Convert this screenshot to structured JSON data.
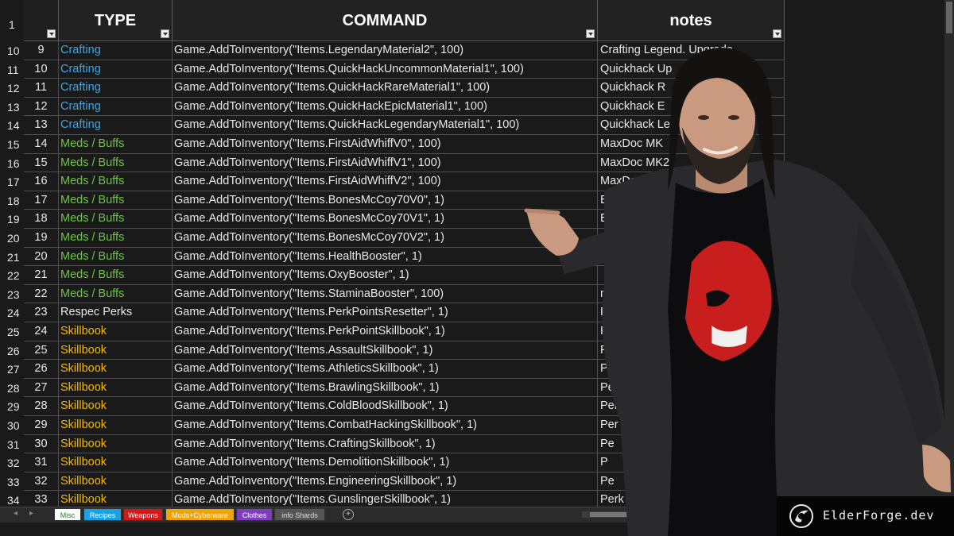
{
  "headers": {
    "type": "TYPE",
    "command": "COMMAND",
    "notes": "notes"
  },
  "first_row_number": "1",
  "colors": {
    "crafting": "#3aa8e8",
    "meds": "#6ec543",
    "skillbook": "#f5b800",
    "default": "#e8e8e8"
  },
  "rows": [
    {
      "row": "10",
      "idx": "9",
      "type": "Crafting",
      "kind": "crafting",
      "command": "Game.AddToInventory(\"Items.LegendaryMaterial2\", 100)",
      "notes": "Crafting Legend. Upgrade"
    },
    {
      "row": "11",
      "idx": "10",
      "type": "Crafting",
      "kind": "crafting",
      "command": "Game.AddToInventory(\"Items.QuickHackUncommonMaterial1\", 100)",
      "notes": "Quickhack Up"
    },
    {
      "row": "12",
      "idx": "11",
      "type": "Crafting",
      "kind": "crafting",
      "command": "Game.AddToInventory(\"Items.QuickHackRareMaterial1\", 100)",
      "notes": "Quickhack R"
    },
    {
      "row": "13",
      "idx": "12",
      "type": "Crafting",
      "kind": "crafting",
      "command": "Game.AddToInventory(\"Items.QuickHackEpicMaterial1\", 100)",
      "notes": "Quickhack E"
    },
    {
      "row": "14",
      "idx": "13",
      "type": "Crafting",
      "kind": "crafting",
      "command": "Game.AddToInventory(\"Items.QuickHackLegendaryMaterial1\", 100)",
      "notes": "Quickhack Le"
    },
    {
      "row": "15",
      "idx": "14",
      "type": "Meds / Buffs",
      "kind": "meds",
      "command": "Game.AddToInventory(\"Items.FirstAidWhiffV0\", 100)",
      "notes": "MaxDoc MK"
    },
    {
      "row": "16",
      "idx": "15",
      "type": "Meds / Buffs",
      "kind": "meds",
      "command": "Game.AddToInventory(\"Items.FirstAidWhiffV1\", 100)",
      "notes": "MaxDoc MK2"
    },
    {
      "row": "17",
      "idx": "16",
      "type": "Meds / Buffs",
      "kind": "meds",
      "command": "Game.AddToInventory(\"Items.FirstAidWhiffV2\", 100)",
      "notes": "MaxDoc MK"
    },
    {
      "row": "18",
      "idx": "17",
      "type": "Meds / Buffs",
      "kind": "meds",
      "command": "Game.AddToInventory(\"Items.BonesMcCoy70V0\", 1)",
      "notes": "Bo"
    },
    {
      "row": "19",
      "idx": "18",
      "type": "Meds / Buffs",
      "kind": "meds",
      "command": "Game.AddToInventory(\"Items.BonesMcCoy70V1\", 1)",
      "notes": "B"
    },
    {
      "row": "20",
      "idx": "19",
      "type": "Meds / Buffs",
      "kind": "meds",
      "command": "Game.AddToInventory(\"Items.BonesMcCoy70V2\", 1)",
      "notes": ""
    },
    {
      "row": "21",
      "idx": "20",
      "type": "Meds / Buffs",
      "kind": "meds",
      "command": "Game.AddToInventory(\"Items.HealthBooster\", 1)",
      "notes": ""
    },
    {
      "row": "22",
      "idx": "21",
      "type": "Meds / Buffs",
      "kind": "meds",
      "command": "Game.AddToInventory(\"Items.OxyBooster\", 1)",
      "notes": ""
    },
    {
      "row": "23",
      "idx": "22",
      "type": "Meds / Buffs",
      "kind": "meds",
      "command": "Game.AddToInventory(\"Items.StaminaBooster\", 100)",
      "notes": "mina"
    },
    {
      "row": "24",
      "idx": "23",
      "type": "Respec Perks",
      "kind": "default",
      "command": "Game.AddToInventory(\"Items.PerkPointsResetter\", 1)",
      "notes": "Reset Pe"
    },
    {
      "row": "25",
      "idx": "24",
      "type": "Skillbook",
      "kind": "skillbook",
      "command": "Game.AddToInventory(\"Items.PerkPointSkillbook\", 1)",
      "notes": "Perk"
    },
    {
      "row": "26",
      "idx": "25",
      "type": "Skillbook",
      "kind": "skillbook",
      "command": "Game.AddToInventory(\"Items.AssaultSkillbook\", 1)",
      "notes": "Perk - A"
    },
    {
      "row": "27",
      "idx": "26",
      "type": "Skillbook",
      "kind": "skillbook",
      "command": "Game.AddToInventory(\"Items.AthleticsSkillbook\", 1)",
      "notes": "Perk - A"
    },
    {
      "row": "28",
      "idx": "27",
      "type": "Skillbook",
      "kind": "skillbook",
      "command": "Game.AddToInventory(\"Items.BrawlingSkillbook\", 1)",
      "notes": "Perk"
    },
    {
      "row": "29",
      "idx": "28",
      "type": "Skillbook",
      "kind": "skillbook",
      "command": "Game.AddToInventory(\"Items.ColdBloodSkillbook\", 1)",
      "notes": "Perk"
    },
    {
      "row": "30",
      "idx": "29",
      "type": "Skillbook",
      "kind": "skillbook",
      "command": "Game.AddToInventory(\"Items.CombatHackingSkillbook\", 1)",
      "notes": "Per"
    },
    {
      "row": "31",
      "idx": "30",
      "type": "Skillbook",
      "kind": "skillbook",
      "command": "Game.AddToInventory(\"Items.CraftingSkillbook\", 1)",
      "notes": "Pe"
    },
    {
      "row": "32",
      "idx": "31",
      "type": "Skillbook",
      "kind": "skillbook",
      "command": "Game.AddToInventory(\"Items.DemolitionSkillbook\", 1)",
      "notes": "P"
    },
    {
      "row": "33",
      "idx": "32",
      "type": "Skillbook",
      "kind": "skillbook",
      "command": "Game.AddToInventory(\"Items.EngineeringSkillbook\", 1)",
      "notes": "Pe"
    },
    {
      "row": "34",
      "idx": "33",
      "type": "Skillbook",
      "kind": "skillbook",
      "command": "Game.AddToInventory(\"Items.GunslingerSkillbook\", 1)",
      "notes": "Perk"
    }
  ],
  "tabs": [
    {
      "label": "Misc",
      "bg": "#ffffff",
      "fg": "#1e7a1e",
      "active": true
    },
    {
      "label": "Recipes",
      "bg": "#1ba1e2",
      "fg": "#ffffff"
    },
    {
      "label": "Weapons",
      "bg": "#d11a1a",
      "fg": "#ffffff"
    },
    {
      "label": "Mods+Cyberware",
      "bg": "#f0a30a",
      "fg": "#ffffff"
    },
    {
      "label": "Clothes",
      "bg": "#7e3fbf",
      "fg": "#ffffff"
    },
    {
      "label": "info Shards",
      "bg": "#555555",
      "fg": "#dddddd"
    }
  ],
  "watermark": {
    "text": "ElderForge.dev"
  },
  "icons": {
    "add_sheet": "+",
    "nav_prev": "◂",
    "nav_next": "▸"
  }
}
